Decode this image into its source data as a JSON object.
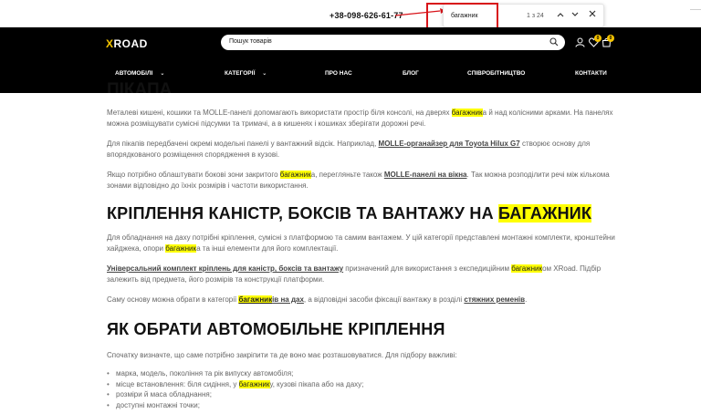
{
  "top": {
    "phone": "+38-098-626-61-77"
  },
  "find": {
    "query": "багажник",
    "count": "1 з 24",
    "prev_icon": "chevron-up-icon",
    "next_icon": "chevron-down-icon",
    "close_icon": "close-icon"
  },
  "header": {
    "logo_x": "X",
    "logo_rest": "ROAD",
    "search_placeholder": "Пошук товарів",
    "wishlist_count": "0",
    "cart_count": "0"
  },
  "nav": [
    {
      "label": "АВТОМОБІЛІ"
    },
    {
      "label": "КАТЕГОРІЇ"
    },
    {
      "label": "ПРО НАС"
    },
    {
      "label": "БЛОГ"
    },
    {
      "label": "СПІВРОБІТНИЦТВО"
    },
    {
      "label": "КОНТАКТИ"
    }
  ],
  "article": {
    "clipped_title": "ПІКАПА",
    "p1": {
      "a": "Металеві кишені, кошики та MOLLE-панелі допомагають використати простір біля консолі, на дверях ",
      "hl": "багажник",
      "b": "а й над колісними арками. На панелях можна розміщувати сумісні підсумки та тримачі, а в кишенях і кошиках зберігати дорожні речі."
    },
    "p2": {
      "a": "Для пікапів передбачені окремі модельні панелі у вантажний відсік. Наприклад, ",
      "link": "MOLLE-органайзер для Toyota Hilux G7",
      "b": " створює основу для впорядкованого розміщення спорядження в кузові."
    },
    "p3": {
      "a": "Якщо потрібно облаштувати бокові зони закритого ",
      "hl": "багажник",
      "b": "а, перегляньте також ",
      "link": "MOLLE-панелі на вікна",
      "c": ". Так можна розподілити речі між кількома зонами відповідно до їхніх розмірів і частоти використання."
    },
    "h2a": {
      "text": "КРІПЛЕННЯ КАНІСТР, БОКСІВ ТА ВАНТАЖУ НА ",
      "hl": "БАГАЖНИК"
    },
    "p4": {
      "a": "Для обладнання на даху потрібні кріплення, сумісні з платформою та самим вантажем. У цій категорії представлені монтажні комплекти, кронштейни хайджека, опори ",
      "hl": "багажник",
      "b": "а та інші елементи для його комплектації."
    },
    "p5": {
      "link": "Універсальний комплект кріплень для каністр, боксів та вантажу",
      "a": " призначений для використання з експедиційним ",
      "hl": "багажник",
      "b": "ом XRoad. Підбір залежить від предмета, його розмірів та конструкції платформи."
    },
    "p6": {
      "a": "Саму основу можна обрати в категорії ",
      "link_hl": "багажник",
      "link_rest": "ів на дах",
      "b": ", а відповідні засоби фіксації вантажу в розділі ",
      "link2": "стяжних ременів",
      "c": "."
    },
    "h2b": "ЯК ОБРАТИ АВТОМОБІЛЬНЕ КРІПЛЕННЯ",
    "p7": "Спочатку визначте, що саме потрібно закріпити та де воно має розташовуватися. Для підбору важливі:",
    "list": [
      {
        "a": "марка, модель, покоління та рік випуску автомобіля;"
      },
      {
        "a": "місце встановлення: біля сидіння, у ",
        "hl": "багажник",
        "b": "у, кузові пікапа або на даху;"
      },
      {
        "a": "розміри й маса обладнання;"
      },
      {
        "a": "доступні монтажні точки;"
      }
    ]
  },
  "colors": {
    "header_bg": "#000000",
    "accent": "#f5c400",
    "find_highlight": "#ffff00",
    "annotation": "#d8141a"
  }
}
